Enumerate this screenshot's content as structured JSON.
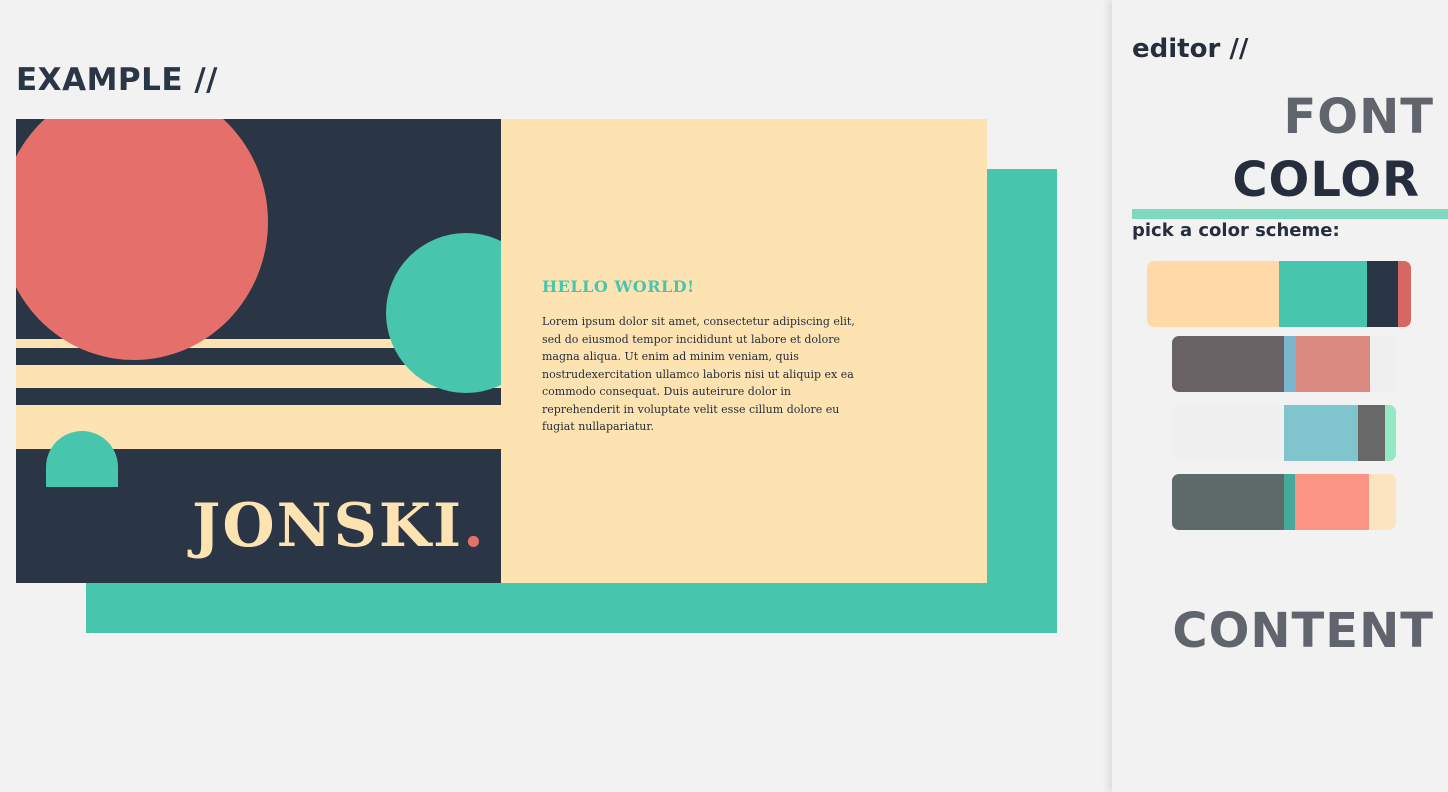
{
  "example": {
    "title": "EXAMPLE //",
    "card": {
      "brand_name": "JONSKI",
      "brand_dot": ".",
      "heading": "HELLO WORLD!",
      "body": "Lorem ipsum dolor sit amet, consectetur adipiscing elit, sed do eiusmod tempor incididunt ut labore et dolore magna aliqua. Ut enim ad minim veniam, quis nostrudexercitation ullamco laboris nisi ut aliquip ex ea commodo consequat. Duis auteirure dolor in reprehenderit in voluptate velit esse cillum dolore eu fugiat nullapariatur."
    }
  },
  "colors": {
    "dark": "#2a3545",
    "cream": "#fde3b1",
    "teal": "#47c5ad",
    "coral": "#e46f6b",
    "page_bg": "#f2f2f2",
    "heading_text": "#262e3e",
    "inactive_text": "#60646d",
    "active_bar": "#7fd8bf"
  },
  "editor": {
    "title": "editor //",
    "sections": [
      {
        "label": "FONT",
        "active": false
      },
      {
        "label": "COLOR",
        "active": true
      },
      {
        "label": "CONTENT",
        "active": false
      }
    ],
    "pick_label": "pick a color scheme:",
    "schemes": [
      {
        "name": "scheme-1",
        "selected": true,
        "colors": [
          "#ffd9a6",
          "#47c5ad",
          "#2a3545",
          "#d66763"
        ],
        "weights": [
          132,
          88,
          31,
          13
        ]
      },
      {
        "name": "scheme-2",
        "selected": false,
        "colors": [
          "#686264",
          "#7ab7cf",
          "#da8a81",
          "#efefef"
        ],
        "weights": [
          112,
          12,
          74,
          26
        ]
      },
      {
        "name": "scheme-3",
        "selected": false,
        "colors": [
          "#f0f0f0",
          "#80c4cd",
          "#686868",
          "#94e8c4"
        ],
        "weights": [
          112,
          74,
          27,
          11
        ]
      },
      {
        "name": "scheme-4",
        "selected": false,
        "colors": [
          "#5e6a6a",
          "#47a89c",
          "#fa9584",
          "#fde4c0"
        ],
        "weights": [
          112,
          11,
          74,
          27
        ]
      }
    ]
  }
}
